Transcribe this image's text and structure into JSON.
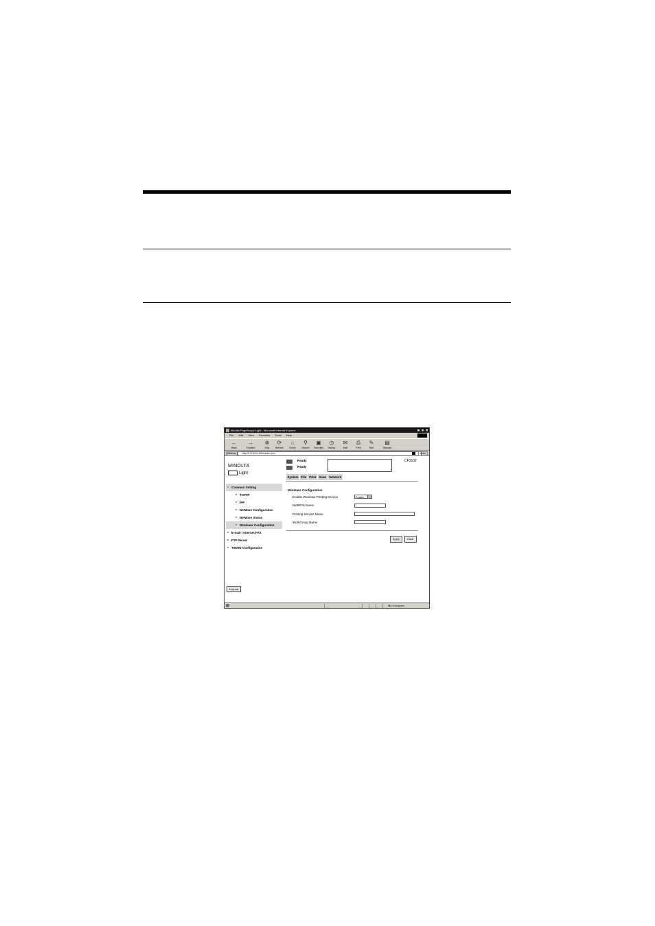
{
  "browser": {
    "title": "Minolta PageScope Light - Microsoft Internet Explorer",
    "menu": [
      "File",
      "Edit",
      "View",
      "Favorites",
      "Tools",
      "Help"
    ],
    "toolbar": [
      "Back",
      "Forward",
      "Stop",
      "Refresh",
      "Home",
      "Search",
      "Favorites",
      "History",
      "Mail",
      "Print",
      "Edit",
      "Discuss"
    ],
    "address_label": "Address",
    "address_value": "http://172.16.8.100/windex.htm",
    "links_label": "Links",
    "status_zone": "My Computer"
  },
  "page": {
    "brand": "MINOLTA",
    "product": "Light",
    "status_1": "Ready",
    "status_2": "Ready",
    "model": "CF3102",
    "tabs": [
      "System",
      "File",
      "Print",
      "Scan",
      "Network"
    ],
    "nav": [
      {
        "label": "Common Setting",
        "level": 0
      },
      {
        "label": "TCP/IP",
        "level": 1
      },
      {
        "label": "IPP",
        "level": 1
      },
      {
        "label": "NetWare Configuration",
        "level": 1
      },
      {
        "label": "NetWare Status",
        "level": 1
      },
      {
        "label": "Windows Configuration",
        "level": 1
      },
      {
        "label": "E-mail / Internet FAX",
        "level": 0
      },
      {
        "label": "FTP Server",
        "level": 0
      },
      {
        "label": "TWAIN Configuration",
        "level": 0
      }
    ],
    "logout": "Log out",
    "section_title": "Windows Configuration",
    "fields": {
      "enable_label": "Enable Windows Printing Service",
      "enable_value": "Enable",
      "netbios_label": "NetBIOS Name",
      "printing_service_label": "Printing Service Name",
      "workgroup_label": "WorkGroup Name"
    },
    "apply": "Apply",
    "clear": "Clear"
  }
}
